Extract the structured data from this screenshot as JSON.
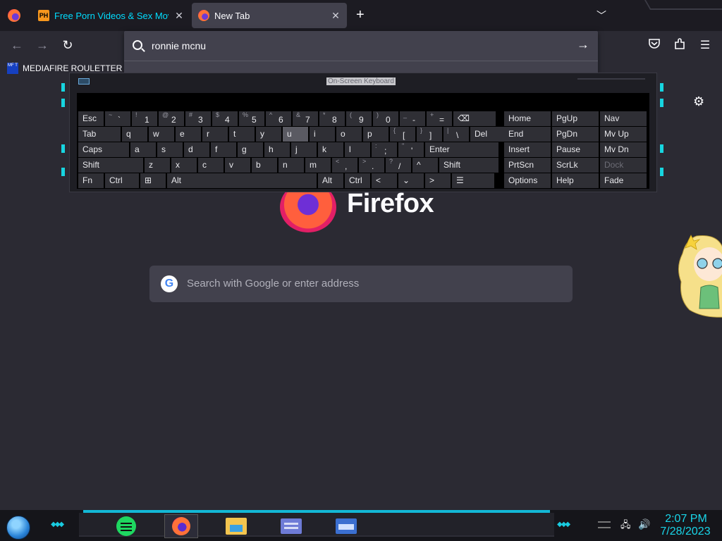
{
  "browser": {
    "tabs": [
      {
        "title": "Free Porn Videos & Sex Movies",
        "favicon": "PH",
        "active": false
      },
      {
        "title": "New Tab",
        "active": true
      }
    ],
    "new_tab_icon": "+",
    "tablist_icon": "chevron-down",
    "address_bar": {
      "value": "ronnie mcnu",
      "go_icon": "arrow-right"
    },
    "bookmarks": [
      {
        "label": "MEDIAFIRE ROULETTER",
        "icon_text": "MF T"
      }
    ],
    "accent": "#00ddff"
  },
  "page": {
    "logo_text": "Firefox",
    "search_placeholder": "Search with Google or enter address",
    "google_letter": "G"
  },
  "keyboard": {
    "title": "On-Screen Keyboard"
  },
  "taskbar": {
    "time": "2:07 PM",
    "date": "7/28/2023",
    "clock_color": "#19d5e8"
  }
}
